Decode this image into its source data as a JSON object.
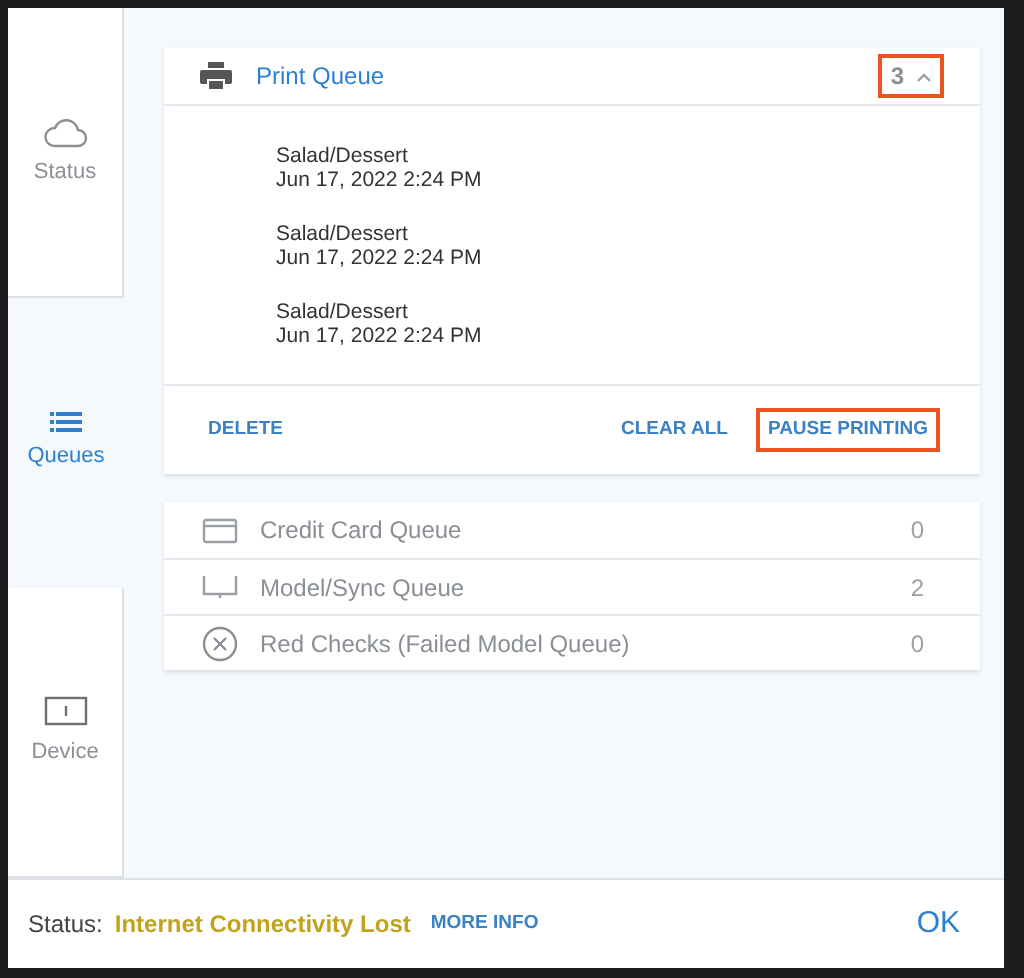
{
  "sidebar": {
    "tabs": [
      {
        "label": "Status",
        "kind": "cloud",
        "selected": false
      },
      {
        "label": "Queues",
        "kind": "list",
        "selected": true
      },
      {
        "label": "Device",
        "kind": "device",
        "selected": false
      }
    ]
  },
  "print_queue": {
    "title": "Print Queue",
    "count": "3",
    "expanded": true,
    "count_highlighted": true,
    "items": [
      {
        "name": "Salad/Dessert",
        "time": "Jun 17, 2022 2:24 PM"
      },
      {
        "name": "Salad/Dessert",
        "time": "Jun 17, 2022 2:24 PM"
      },
      {
        "name": "Salad/Dessert",
        "time": "Jun 17, 2022 2:24 PM"
      }
    ],
    "actions": [
      {
        "label": "DELETE",
        "highlighted": false
      },
      {
        "label": "CLEAR ALL",
        "highlighted": false
      },
      {
        "label": "PAUSE PRINTING",
        "highlighted": true
      }
    ]
  },
  "queues": [
    {
      "kind": "card",
      "label": "Credit Card Queue",
      "count": "0"
    },
    {
      "kind": "monitor",
      "label": "Model/Sync Queue",
      "count": "2"
    },
    {
      "kind": "failed",
      "label": "Red Checks (Failed Model Queue)",
      "count": "0"
    }
  ],
  "footer": {
    "label": "Status:",
    "status": "Internet Connectivity Lost",
    "link": "MORE INFO",
    "button": "OK"
  }
}
